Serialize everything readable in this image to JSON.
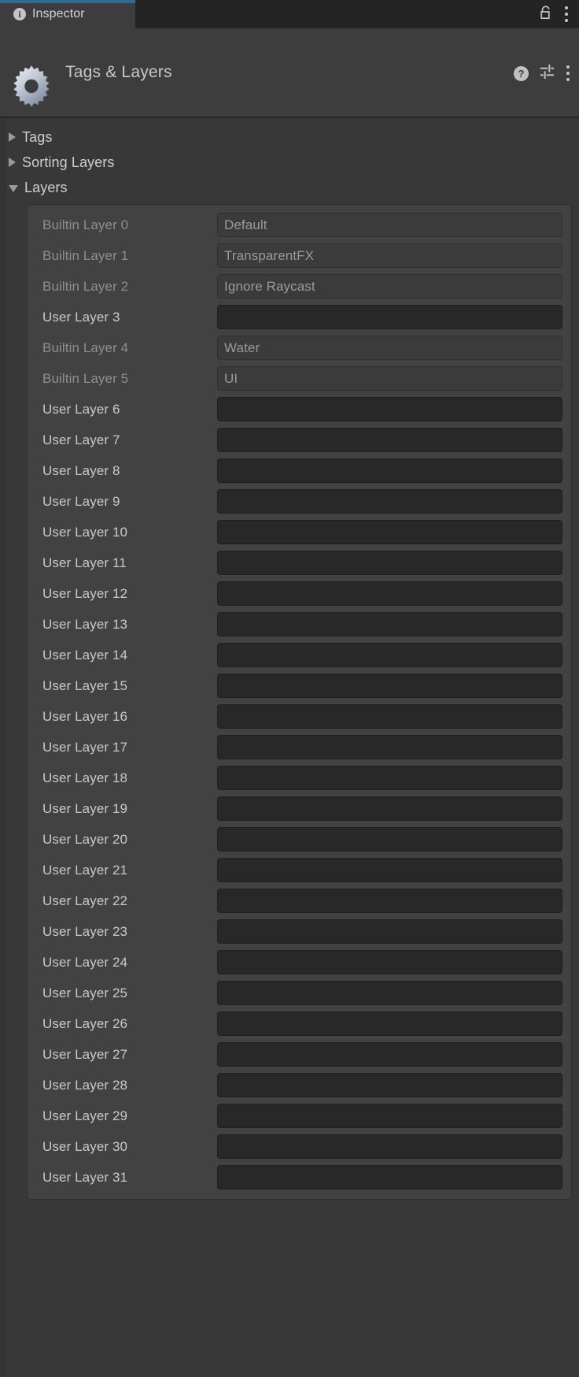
{
  "window": {
    "tab": {
      "label": "Inspector",
      "icon": "info-icon",
      "accent_color": "#2c6a99"
    },
    "tabbar_controls": [
      {
        "name": "lock-icon",
        "label": "Lock"
      },
      {
        "name": "tabbar-menu-icon",
        "label": "More"
      }
    ]
  },
  "header": {
    "icon": "gear-icon",
    "title": "Tags & Layers",
    "controls": [
      {
        "name": "help-icon",
        "label": "?"
      },
      {
        "name": "preset-settings-icon",
        "label": "Presets"
      },
      {
        "name": "header-menu-icon",
        "label": "More"
      }
    ]
  },
  "foldouts": [
    {
      "label": "Tags",
      "expanded": false
    },
    {
      "label": "Sorting Layers",
      "expanded": false
    },
    {
      "label": "Layers",
      "expanded": true
    }
  ],
  "layers": {
    "rows": [
      {
        "label": "Builtin Layer 0",
        "value": "Default",
        "builtin": true
      },
      {
        "label": "Builtin Layer 1",
        "value": "TransparentFX",
        "builtin": true
      },
      {
        "label": "Builtin Layer 2",
        "value": "Ignore Raycast",
        "builtin": true
      },
      {
        "label": "User Layer 3",
        "value": "",
        "builtin": false
      },
      {
        "label": "Builtin Layer 4",
        "value": "Water",
        "builtin": true
      },
      {
        "label": "Builtin Layer 5",
        "value": "UI",
        "builtin": true
      },
      {
        "label": "User Layer 6",
        "value": "",
        "builtin": false
      },
      {
        "label": "User Layer 7",
        "value": "",
        "builtin": false
      },
      {
        "label": "User Layer 8",
        "value": "",
        "builtin": false
      },
      {
        "label": "User Layer 9",
        "value": "",
        "builtin": false
      },
      {
        "label": "User Layer 10",
        "value": "",
        "builtin": false
      },
      {
        "label": "User Layer 11",
        "value": "",
        "builtin": false
      },
      {
        "label": "User Layer 12",
        "value": "",
        "builtin": false
      },
      {
        "label": "User Layer 13",
        "value": "",
        "builtin": false
      },
      {
        "label": "User Layer 14",
        "value": "",
        "builtin": false
      },
      {
        "label": "User Layer 15",
        "value": "",
        "builtin": false
      },
      {
        "label": "User Layer 16",
        "value": "",
        "builtin": false
      },
      {
        "label": "User Layer 17",
        "value": "",
        "builtin": false
      },
      {
        "label": "User Layer 18",
        "value": "",
        "builtin": false
      },
      {
        "label": "User Layer 19",
        "value": "",
        "builtin": false
      },
      {
        "label": "User Layer 20",
        "value": "",
        "builtin": false
      },
      {
        "label": "User Layer 21",
        "value": "",
        "builtin": false
      },
      {
        "label": "User Layer 22",
        "value": "",
        "builtin": false
      },
      {
        "label": "User Layer 23",
        "value": "",
        "builtin": false
      },
      {
        "label": "User Layer 24",
        "value": "",
        "builtin": false
      },
      {
        "label": "User Layer 25",
        "value": "",
        "builtin": false
      },
      {
        "label": "User Layer 26",
        "value": "",
        "builtin": false
      },
      {
        "label": "User Layer 27",
        "value": "",
        "builtin": false
      },
      {
        "label": "User Layer 28",
        "value": "",
        "builtin": false
      },
      {
        "label": "User Layer 29",
        "value": "",
        "builtin": false
      },
      {
        "label": "User Layer 30",
        "value": "",
        "builtin": false
      },
      {
        "label": "User Layer 31",
        "value": "",
        "builtin": false
      }
    ]
  }
}
